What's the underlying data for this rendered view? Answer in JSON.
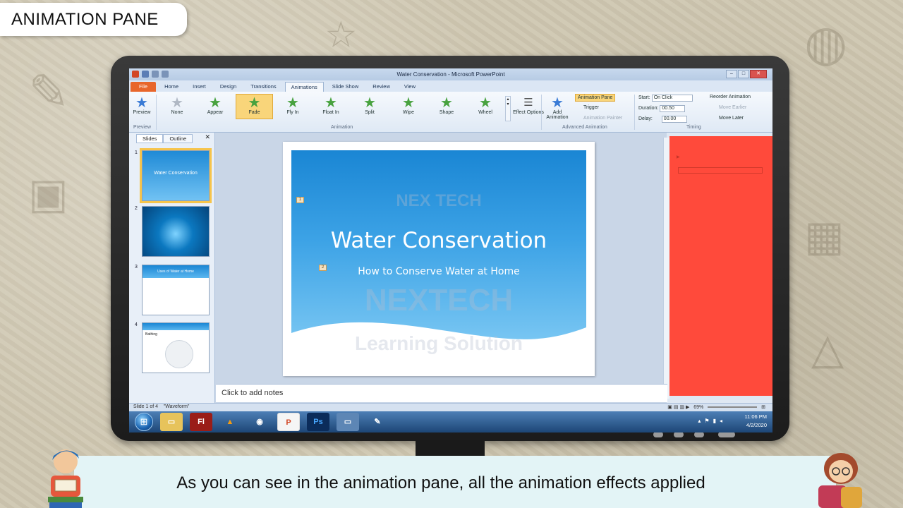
{
  "lesson_title": "ANIMATION PANE",
  "caption": "As you can see in the animation pane, all the animation effects applied",
  "window": {
    "title": "Water Conservation - Microsoft PowerPoint",
    "controls": [
      "–",
      "□",
      "✕"
    ]
  },
  "ribbon_tabs": [
    "File",
    "Home",
    "Insert",
    "Design",
    "Transitions",
    "Animations",
    "Slide Show",
    "Review",
    "View"
  ],
  "active_tab": "Animations",
  "ribbon": {
    "preview_label": "Preview",
    "preview_group": "Preview",
    "effects": [
      "None",
      "Appear",
      "Fade",
      "Fly In",
      "Float In",
      "Split",
      "Wipe",
      "Shape",
      "Wheel"
    ],
    "animation_group": "Animation",
    "effect_options": "Effect Options",
    "add_animation": "Add Animation",
    "animation_pane_btn": "Animation Pane",
    "trigger": "Trigger",
    "animation_painter": "Animation Painter",
    "advanced_group": "Advanced Animation",
    "start_label": "Start:",
    "start_value": "On Click",
    "duration_label": "Duration:",
    "duration_value": "00.50",
    "delay_label": "Delay:",
    "delay_value": "00.00",
    "reorder_label": "Reorder Animation",
    "move_earlier": "Move Earlier",
    "move_later": "Move Later",
    "timing_group": "Timing"
  },
  "slides_panel": {
    "tabs": [
      "Slides",
      "Outline"
    ],
    "thumbnails": [
      {
        "num": "1",
        "title": "Water Conservation"
      },
      {
        "num": "2",
        "title": ""
      },
      {
        "num": "3",
        "title": "Uses of Water at Home"
      },
      {
        "num": "4",
        "title": "Bathing"
      }
    ]
  },
  "slide": {
    "title": "Water Conservation",
    "subtitle": "How to Conserve Water at Home",
    "tag1": "1",
    "tag2": "2",
    "watermark_line1": "NEX TECH",
    "watermark_line2": "NEXTECH",
    "watermark_line3": "Learning Solution"
  },
  "notes_placeholder": "Click to add notes",
  "status": {
    "slide_info": "Slide 1 of 4",
    "theme": "\"Waveform\"",
    "zoom": "69%"
  },
  "taskbar": {
    "time": "11:06 PM",
    "date": "4/2/2020",
    "apps": [
      "explorer",
      "flash",
      "vlc",
      "chrome",
      "powerpoint",
      "photoshop",
      "window",
      "paint"
    ]
  }
}
